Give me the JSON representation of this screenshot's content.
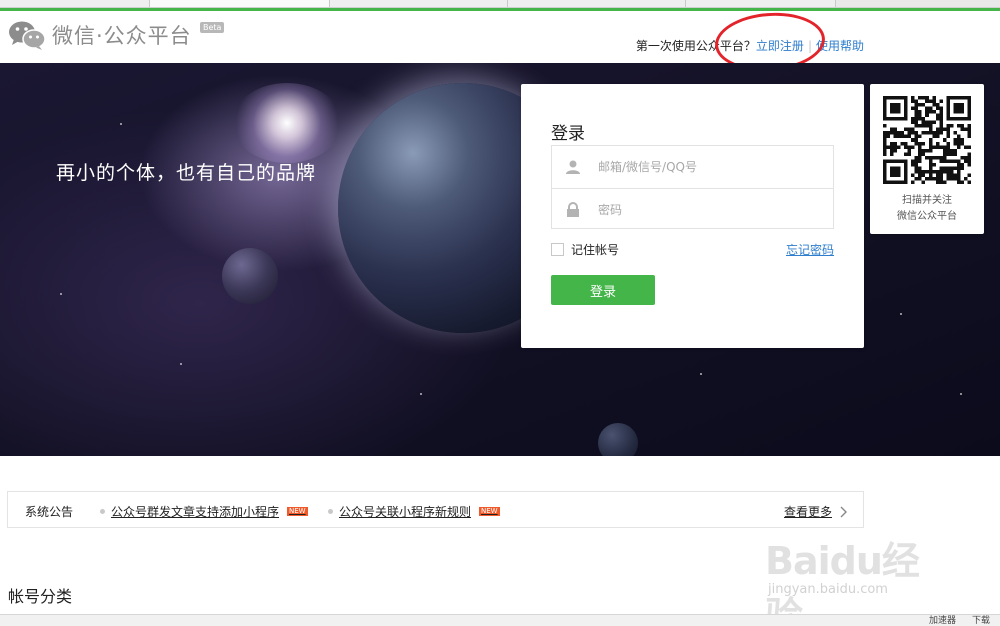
{
  "header": {
    "logo_text": "微信·公众平台",
    "beta_badge": "Beta",
    "prompt": "第一次使用公众平台？",
    "register_link": "立即注册",
    "separator": "|",
    "help_link": "使用帮助",
    "annotation_color": "#e3242b"
  },
  "banner": {
    "slogan": "再小的个体，也有自己的品牌"
  },
  "login": {
    "title": "登录",
    "account_placeholder": "邮箱/微信号/QQ号",
    "password_placeholder": "密码",
    "remember_label": "记住帐号",
    "remember_checked": false,
    "forgot_link": "忘记密码",
    "submit_label": "登录"
  },
  "qr": {
    "caption_line1": "扫描并关注",
    "caption_line2": "微信公众平台"
  },
  "notice": {
    "label": "系统公告",
    "items": [
      {
        "text": "公众号群发文章支持添加小程序",
        "badge": "NEW"
      },
      {
        "text": "公众号关联小程序新规则",
        "badge": "NEW"
      }
    ],
    "more_label": "查看更多"
  },
  "section": {
    "title": "帐号分类"
  },
  "statusbar": {
    "items": [
      "加速器",
      "下载"
    ]
  },
  "watermark": {
    "main": "Baidu经验",
    "sub": "jingyan.baidu.com"
  },
  "colors": {
    "brand_green": "#44b549",
    "link_blue": "#2e7ecd"
  }
}
